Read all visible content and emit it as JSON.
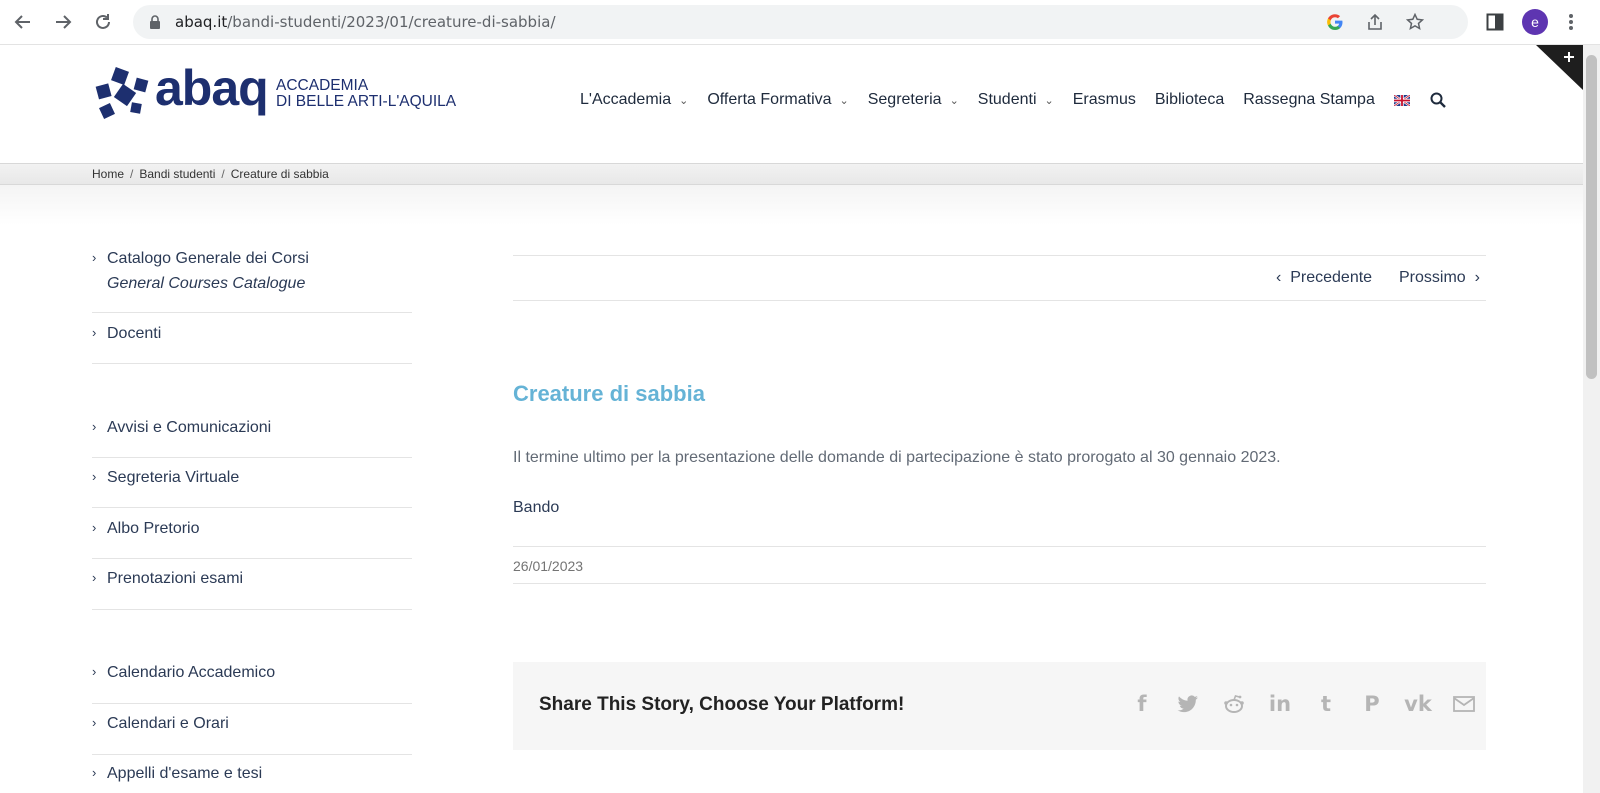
{
  "browser": {
    "url_domain": "abaq.it",
    "url_path": "/bandi-studenti/2023/01/creature-di-sabbia/",
    "profile_initial": "e",
    "icons": [
      "back-icon",
      "forward-icon",
      "reload-icon",
      "lock-icon",
      "google-icon",
      "share-icon",
      "star-icon",
      "side-panel-icon",
      "kebab-menu-icon"
    ]
  },
  "site": {
    "logo_word": "abaq",
    "logo_line1": "ACCADEMIA",
    "logo_line2": "DI BELLE ARTI-L'AQUILA",
    "brand_color": "#1d2f6f",
    "title_color": "#65b3d6"
  },
  "nav": {
    "items": [
      {
        "label": "L'Accademia",
        "dropdown": true
      },
      {
        "label": "Offerta Formativa",
        "dropdown": true
      },
      {
        "label": "Segreteria",
        "dropdown": true
      },
      {
        "label": "Studenti",
        "dropdown": true
      },
      {
        "label": "Erasmus",
        "dropdown": false
      },
      {
        "label": "Biblioteca",
        "dropdown": false
      },
      {
        "label": "Rassegna Stampa",
        "dropdown": false
      }
    ],
    "language_icon": "uk-flag-icon",
    "search_icon": "search-icon"
  },
  "breadcrumb": {
    "home": "Home",
    "section": "Bandi studenti",
    "current": "Creature di sabbia",
    "separator": "/"
  },
  "sidebar": {
    "items": [
      {
        "label": "Catalogo Generale dei Corsi",
        "sub": "General Courses Catalogue"
      },
      {
        "label": "Docenti"
      },
      {
        "label": "Avvisi e Comunicazioni"
      },
      {
        "label": "Segreteria Virtuale"
      },
      {
        "label": "Albo Pretorio"
      },
      {
        "label": "Prenotazioni esami"
      },
      {
        "label": "Calendario Accademico"
      },
      {
        "label": "Calendari e Orari"
      },
      {
        "label": "Appelli d'esame e tesi"
      }
    ]
  },
  "post": {
    "prev_label": "Precedente",
    "next_label": "Prossimo",
    "title": "Creature di sabbia",
    "body": "Il termine ultimo per la presentazione delle domande di partecipazione è stato prorogato al 30 gennaio 2023.",
    "link_label": "Bando",
    "date": "26/01/2023"
  },
  "share": {
    "heading": "Share This Story, Choose Your Platform!",
    "platforms": [
      {
        "name": "facebook-icon",
        "glyph": "f"
      },
      {
        "name": "twitter-icon",
        "glyph": "🐦"
      },
      {
        "name": "reddit-icon",
        "glyph": "◉"
      },
      {
        "name": "linkedin-icon",
        "glyph": "in"
      },
      {
        "name": "tumblr-icon",
        "glyph": "t"
      },
      {
        "name": "pinterest-icon",
        "glyph": "P"
      },
      {
        "name": "vk-icon",
        "glyph": "vk"
      },
      {
        "name": "email-icon",
        "glyph": "✉"
      }
    ]
  }
}
